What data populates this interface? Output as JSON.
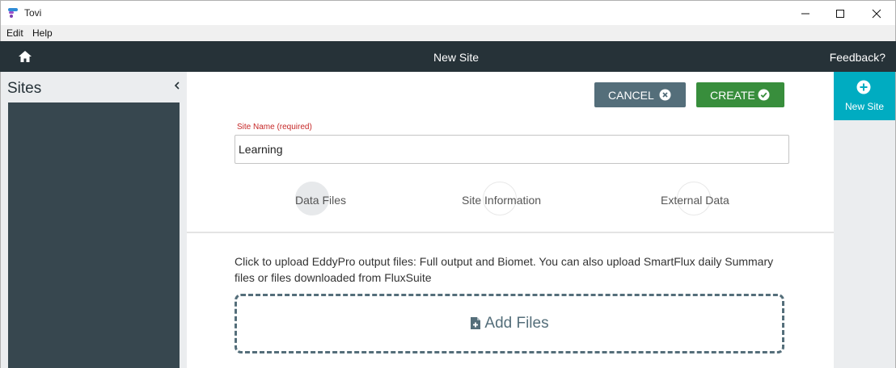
{
  "window": {
    "title": "Tovi",
    "controls": {
      "minimize": "minimize-icon",
      "maximize": "maximize-icon",
      "close": "close-icon"
    }
  },
  "menu": {
    "items": [
      "Edit",
      "Help"
    ]
  },
  "header": {
    "title": "New Site",
    "feedback_label": "Feedback?",
    "background": "#263238"
  },
  "sidebar": {
    "title": "Sites",
    "collapse_icon": "chevron-left-icon"
  },
  "toolbar": {
    "cancel_label": "CANCEL",
    "create_label": "CREATE",
    "cancel_color": "#546e7a",
    "create_color": "#388e3c"
  },
  "form": {
    "site_name_label": "Site Name (required)",
    "site_name_value": "Learning",
    "label_color": "#c62828"
  },
  "steps": [
    {
      "label": "Data Files",
      "active": true
    },
    {
      "label": "Site Information",
      "active": false
    },
    {
      "label": "External Data",
      "active": false
    }
  ],
  "upload": {
    "instructions": "Click to upload EddyPro output files: Full output and Biomet. You can also upload SmartFlux daily Summary files or files downloaded from FluxSuite",
    "add_files_label": "Add Files",
    "icon": "file-plus-icon"
  },
  "right_panel": {
    "new_site_label": "New Site",
    "accent": "#00acc1"
  }
}
